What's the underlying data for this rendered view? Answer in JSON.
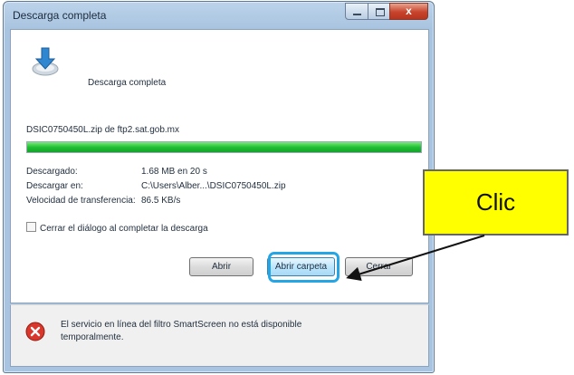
{
  "window": {
    "title": "Descarga completa",
    "close_glyph": "x"
  },
  "dialog": {
    "heading": "Descarga completa",
    "file_source": "DSIC0750450L.zip de ftp2.sat.gob.mx",
    "progress": 1.0,
    "info": [
      {
        "label": "Descargado:",
        "value": "1.68 MB en 20 s"
      },
      {
        "label": "Descargar en:",
        "value": "C:\\Users\\Alber...\\DSIC0750450L.zip"
      },
      {
        "label": "Velocidad de transferencia:",
        "value": "86.5 KB/s"
      }
    ],
    "close_on_complete_label": "Cerrar el diálogo al completar la descarga",
    "close_on_complete_checked": false,
    "buttons": {
      "open": "Abrir",
      "open_folder": "Abrir carpeta",
      "close": "Cerrar"
    },
    "footer_message": "El servicio en línea del filtro SmartScreen no está disponible temporalmente."
  },
  "annotation": {
    "callout_text": "Clic",
    "callout_color": "#ffff00",
    "highlight_color": "#23a5e6"
  },
  "icons": {
    "download": "download-arrow-icon",
    "shield": "smartscreen-error-icon"
  }
}
